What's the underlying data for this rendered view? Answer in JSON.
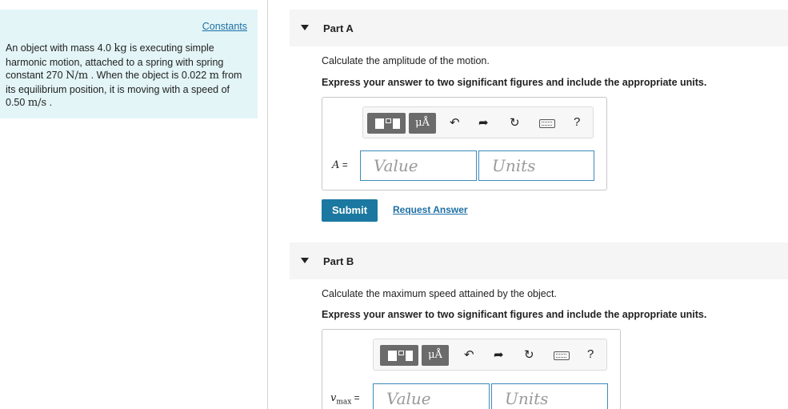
{
  "left_panel": {
    "constants_link": "Constants",
    "problem": {
      "t1": "An object with mass 4.0 ",
      "m1": "kg",
      "t2": " is executing simple harmonic motion, attached to a spring with spring constant 270 ",
      "m2": "N/m",
      "t3": " . When the object is 0.022 ",
      "m3": "m",
      "t4": " from its equilibrium position, it is moving with a speed of 0.50 ",
      "m4": "m/s",
      "t5": " ."
    }
  },
  "part_a": {
    "label": "Part A",
    "question": "Calculate the amplitude of the motion.",
    "instruction": "Express your answer to two significant figures and include the appropriate units.",
    "var": "A",
    "eq": " =",
    "value_placeholder": "Value",
    "units_placeholder": "Units",
    "submit_label": "Submit",
    "request_label": "Request Answer"
  },
  "part_b": {
    "label": "Part B",
    "question": "Calculate the maximum speed attained by the object.",
    "instruction": "Express your answer to two significant figures and include the appropriate units.",
    "var": "v",
    "var_sub": "max",
    "eq": " =",
    "value_placeholder": "Value",
    "units_placeholder": "Units"
  },
  "toolbar": {
    "mu_label": "μÅ",
    "undo_icon": "undo-arrow-icon",
    "redo_icon": "redo-arrow-icon",
    "reset_icon": "reset-icon",
    "keyboard_icon": "keyboard-icon",
    "help_label": "?"
  },
  "colors": {
    "panel_bg": "#e3f5f7",
    "link": "#1d6fa5",
    "submit_bg": "#1b78a0",
    "field_border": "#3d8ab8"
  }
}
